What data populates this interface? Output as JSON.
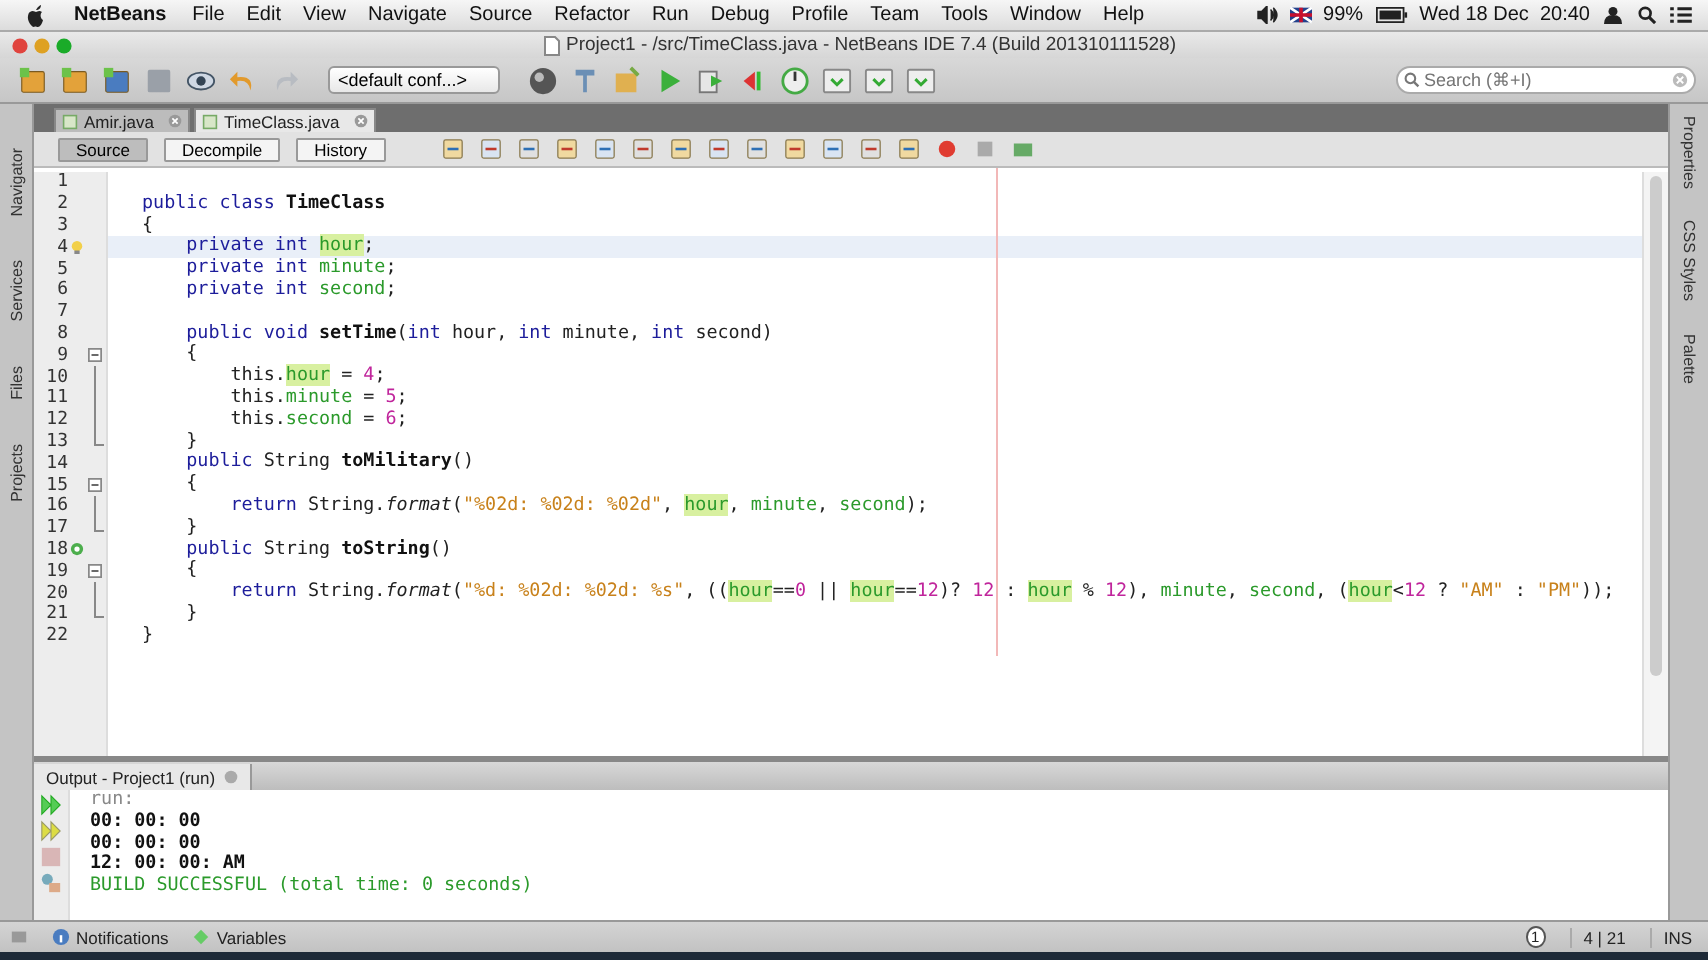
{
  "menubar": {
    "app": "NetBeans",
    "menus": [
      "File",
      "Edit",
      "View",
      "Navigate",
      "Source",
      "Refactor",
      "Run",
      "Debug",
      "Profile",
      "Team",
      "Tools",
      "Window",
      "Help"
    ],
    "battery": "99%",
    "clock": "Wed 18 Dec  20:40"
  },
  "window": {
    "title": "Project1 - /src/TimeClass.java - NetBeans IDE 7.4 (Build 201310111528)"
  },
  "toolbar": {
    "config": "<default conf...>",
    "search": {
      "placeholder": "Search (⌘+I)"
    }
  },
  "editor_tabs": [
    {
      "label": "Amir.java",
      "selected": false
    },
    {
      "label": "TimeClass.java",
      "selected": true
    }
  ],
  "view_buttons": [
    {
      "label": "Source",
      "selected": true
    },
    {
      "label": "Decompile",
      "selected": false
    },
    {
      "label": "History",
      "selected": false
    }
  ],
  "left_panels": [
    "Navigator",
    "Services",
    "Files",
    "Projects"
  ],
  "right_panels": [
    "Properties",
    "CSS Styles",
    "Palette"
  ],
  "code": [
    {
      "num": "1"
    },
    {
      "num": "2",
      "tokens": [
        {
          "kind": "k",
          "text": "public class "
        },
        {
          "kind": "b",
          "text": "TimeClass"
        }
      ]
    },
    {
      "num": "3",
      "tokens": [
        {
          "kind": "p",
          "text": "{"
        }
      ]
    },
    {
      "num": "4",
      "current": true,
      "hint": true,
      "tokens": [
        {
          "kind": "k",
          "text": "    private int "
        },
        {
          "kind": "fh",
          "text": "hour"
        },
        {
          "kind": "p",
          "text": ";"
        }
      ]
    },
    {
      "num": "5",
      "tokens": [
        {
          "kind": "k",
          "text": "    private int "
        },
        {
          "kind": "f",
          "text": "minute"
        },
        {
          "kind": "p",
          "text": ";"
        }
      ]
    },
    {
      "num": "6",
      "tokens": [
        {
          "kind": "k",
          "text": "    private int "
        },
        {
          "kind": "f",
          "text": "second"
        },
        {
          "kind": "p",
          "text": ";"
        }
      ]
    },
    {
      "num": "7"
    },
    {
      "num": "8",
      "tokens": [
        {
          "kind": "k",
          "text": "    public void "
        },
        {
          "kind": "b",
          "text": "setTime"
        },
        {
          "kind": "p",
          "text": "("
        },
        {
          "kind": "k",
          "text": "int"
        },
        {
          "kind": "p",
          "text": " hour, "
        },
        {
          "kind": "k",
          "text": "int"
        },
        {
          "kind": "p",
          "text": " minute, "
        },
        {
          "kind": "k",
          "text": "int"
        },
        {
          "kind": "p",
          "text": " second)"
        }
      ]
    },
    {
      "num": "9",
      "fold": {
        "kind": "start"
      },
      "tokens": [
        {
          "kind": "p",
          "text": "    {"
        }
      ]
    },
    {
      "num": "10",
      "fold": {
        "kind": "mid"
      },
      "tokens": [
        {
          "kind": "p",
          "text": "        this."
        },
        {
          "kind": "fh",
          "text": "hour"
        },
        {
          "kind": "p",
          "text": " = "
        },
        {
          "kind": "n",
          "text": "4"
        },
        {
          "kind": "p",
          "text": ";"
        }
      ]
    },
    {
      "num": "11",
      "fold": {
        "kind": "mid"
      },
      "tokens": [
        {
          "kind": "p",
          "text": "        this."
        },
        {
          "kind": "f",
          "text": "minute"
        },
        {
          "kind": "p",
          "text": " = "
        },
        {
          "kind": "n",
          "text": "5"
        },
        {
          "kind": "p",
          "text": ";"
        }
      ]
    },
    {
      "num": "12",
      "fold": {
        "kind": "mid"
      },
      "tokens": [
        {
          "kind": "p",
          "text": "        this."
        },
        {
          "kind": "f",
          "text": "second"
        },
        {
          "kind": "p",
          "text": " = "
        },
        {
          "kind": "n",
          "text": "6"
        },
        {
          "kind": "p",
          "text": ";"
        }
      ]
    },
    {
      "num": "13",
      "fold": {
        "kind": "end"
      },
      "tokens": [
        {
          "kind": "p",
          "text": "    }"
        }
      ]
    },
    {
      "num": "14",
      "tokens": [
        {
          "kind": "k",
          "text": "    public "
        },
        {
          "kind": "p",
          "text": "String "
        },
        {
          "kind": "b",
          "text": "toMilitary"
        },
        {
          "kind": "p",
          "text": "()"
        }
      ]
    },
    {
      "num": "15",
      "fold": {
        "kind": "start"
      },
      "tokens": [
        {
          "kind": "p",
          "text": "    {"
        }
      ]
    },
    {
      "num": "16",
      "fold": {
        "kind": "mid"
      },
      "tokens": [
        {
          "kind": "k",
          "text": "        return "
        },
        {
          "kind": "p",
          "text": "String."
        },
        {
          "kind": "i",
          "text": "format"
        },
        {
          "kind": "p",
          "text": "("
        },
        {
          "kind": "s",
          "text": "\"%02d: %02d: %02d\""
        },
        {
          "kind": "p",
          "text": ", "
        },
        {
          "kind": "fh",
          "text": "hour"
        },
        {
          "kind": "p",
          "text": ", "
        },
        {
          "kind": "f",
          "text": "minute"
        },
        {
          "kind": "p",
          "text": ", "
        },
        {
          "kind": "f",
          "text": "second"
        },
        {
          "kind": "p",
          "text": ");"
        }
      ]
    },
    {
      "num": "17",
      "fold": {
        "kind": "end"
      },
      "tokens": [
        {
          "kind": "p",
          "text": "    }"
        }
      ]
    },
    {
      "num": "18",
      "overrides": true,
      "tokens": [
        {
          "kind": "k",
          "text": "    public "
        },
        {
          "kind": "p",
          "text": "String "
        },
        {
          "kind": "b",
          "text": "toString"
        },
        {
          "kind": "p",
          "text": "()"
        }
      ]
    },
    {
      "num": "19",
      "fold": {
        "kind": "start"
      },
      "tokens": [
        {
          "kind": "p",
          "text": "    {"
        }
      ]
    },
    {
      "num": "20",
      "fold": {
        "kind": "mid"
      },
      "tokens": [
        {
          "kind": "k",
          "text": "        return "
        },
        {
          "kind": "p",
          "text": "String."
        },
        {
          "kind": "i",
          "text": "format"
        },
        {
          "kind": "p",
          "text": "("
        },
        {
          "kind": "s",
          "text": "\"%d: %02d: %02d: %s\""
        },
        {
          "kind": "p",
          "text": ", (("
        },
        {
          "kind": "fh",
          "text": "hour"
        },
        {
          "kind": "p",
          "text": "=="
        },
        {
          "kind": "n",
          "text": "0"
        },
        {
          "kind": "p",
          "text": " || "
        },
        {
          "kind": "fh",
          "text": "hour"
        },
        {
          "kind": "p",
          "text": "=="
        },
        {
          "kind": "n",
          "text": "12"
        },
        {
          "kind": "p",
          "text": ")? "
        },
        {
          "kind": "n",
          "text": "12"
        },
        {
          "kind": "p",
          "text": " : "
        },
        {
          "kind": "fh",
          "text": "hour"
        },
        {
          "kind": "p",
          "text": " % "
        },
        {
          "kind": "n",
          "text": "12"
        },
        {
          "kind": "p",
          "text": "), "
        },
        {
          "kind": "f",
          "text": "minute"
        },
        {
          "kind": "p",
          "text": ", "
        },
        {
          "kind": "f",
          "text": "second"
        },
        {
          "kind": "p",
          "text": ", ("
        },
        {
          "kind": "fh",
          "text": "hour"
        },
        {
          "kind": "p",
          "text": "<"
        },
        {
          "kind": "n",
          "text": "12"
        },
        {
          "kind": "p",
          "text": " ? "
        },
        {
          "kind": "s",
          "text": "\"AM\""
        },
        {
          "kind": "p",
          "text": " : "
        },
        {
          "kind": "s",
          "text": "\"PM\""
        },
        {
          "kind": "p",
          "text": "));"
        }
      ]
    },
    {
      "num": "21",
      "fold": {
        "kind": "end"
      },
      "tokens": [
        {
          "kind": "p",
          "text": "    }"
        }
      ]
    },
    {
      "num": "22",
      "tokens": [
        {
          "kind": "p",
          "text": "}"
        }
      ]
    }
  ],
  "output": {
    "title": "Output - Project1 (run)",
    "lines": [
      {
        "kind": "muted",
        "text": "run:"
      },
      {
        "kind": "plain",
        "text": "00: 00: 00"
      },
      {
        "kind": "plain",
        "text": "00: 00: 00"
      },
      {
        "kind": "plain",
        "text": "12: 00: 00: AM"
      },
      {
        "kind": "success",
        "text": "BUILD SUCCESSFUL (total time: 0 seconds)"
      }
    ]
  },
  "status_bar": {
    "items": [
      "Notifications",
      "Variables"
    ],
    "badge": "1",
    "position": "4 | 21",
    "mode": "INS"
  }
}
